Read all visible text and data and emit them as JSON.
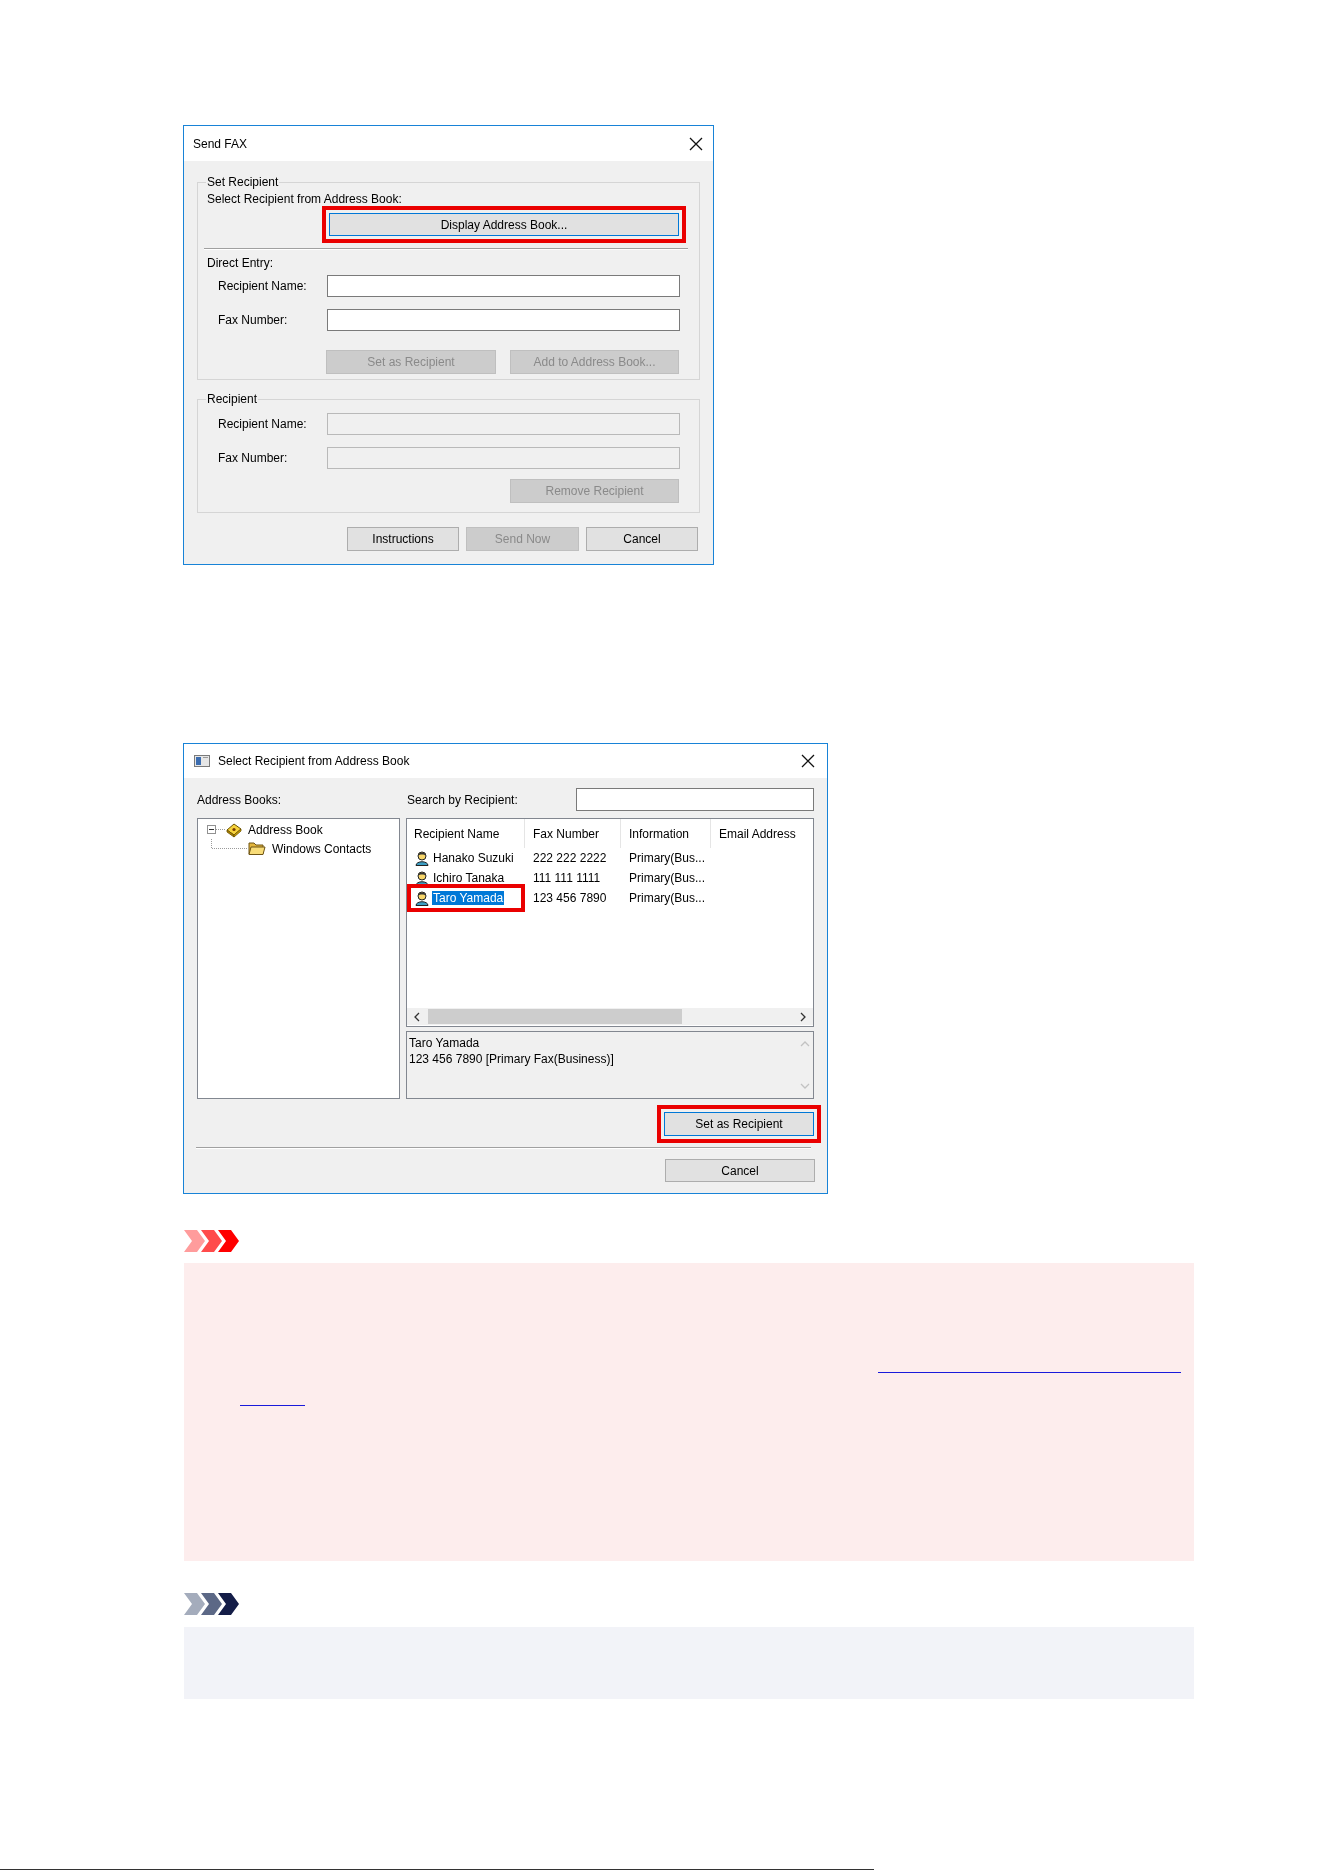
{
  "send_fax_dialog": {
    "title": "Send FAX",
    "set_recipient": {
      "label": "Set Recipient",
      "prompt": "Select Recipient from Address Book:",
      "address_book_button": {
        "label": "Display Address Book...",
        "focused": true,
        "highlighted": true
      },
      "direct_entry_label": "Direct Entry:",
      "fields": [
        {
          "label": "Recipient Name:",
          "disabled": false
        },
        {
          "label": "Fax Number:",
          "disabled": false
        }
      ],
      "buttons": [
        {
          "label": "Set as Recipient",
          "disabled": true
        },
        {
          "label": "Add to Address Book...",
          "disabled": true
        }
      ]
    },
    "recipient": {
      "label": "Recipient",
      "fields": [
        {
          "label": "Recipient Name:",
          "disabled": true
        },
        {
          "label": "Fax Number:",
          "disabled": true
        }
      ],
      "buttons": [
        {
          "label": "Remove Recipient",
          "disabled": true
        }
      ]
    },
    "buttons": [
      {
        "label": "Instructions",
        "disabled": false
      },
      {
        "label": "Send Now",
        "disabled": true
      },
      {
        "label": "Cancel",
        "disabled": false
      }
    ]
  },
  "address_book_dialog": {
    "title": "Select Recipient from Address Book",
    "address_books_label": "Address Books:",
    "tree": [
      {
        "label": "Address Book",
        "kind": "book",
        "expanded": true,
        "children": [
          {
            "label": "Windows Contacts",
            "kind": "folder"
          }
        ]
      }
    ],
    "search": {
      "label": "Search by Recipient:"
    },
    "list": {
      "columns": [
        "Recipient Name",
        "Fax Number",
        "Information",
        "Email Address"
      ],
      "rows": [
        {
          "cells": [
            "Hanako Suzuki",
            "222 222 2222",
            "Primary(Bus..."
          ],
          "selected": false,
          "highlighted": false
        },
        {
          "cells": [
            "Ichiro Tanaka",
            "111 111 1111",
            "Primary(Bus..."
          ],
          "selected": false,
          "highlighted": false
        },
        {
          "cells": [
            "Taro Yamada",
            "123 456 7890",
            "Primary(Bus..."
          ],
          "selected": true,
          "highlighted": true
        }
      ]
    },
    "details": [
      "Taro Yamada",
      "123 456 7890 [Primary Fax(Business)]"
    ],
    "buttons": [
      {
        "label": "Set as Recipient",
        "focused": true,
        "highlighted": true
      },
      {
        "label": "Cancel",
        "focused": false,
        "highlighted": false
      }
    ]
  },
  "notices": [
    {
      "kind": "important"
    },
    {
      "kind": "note"
    }
  ]
}
